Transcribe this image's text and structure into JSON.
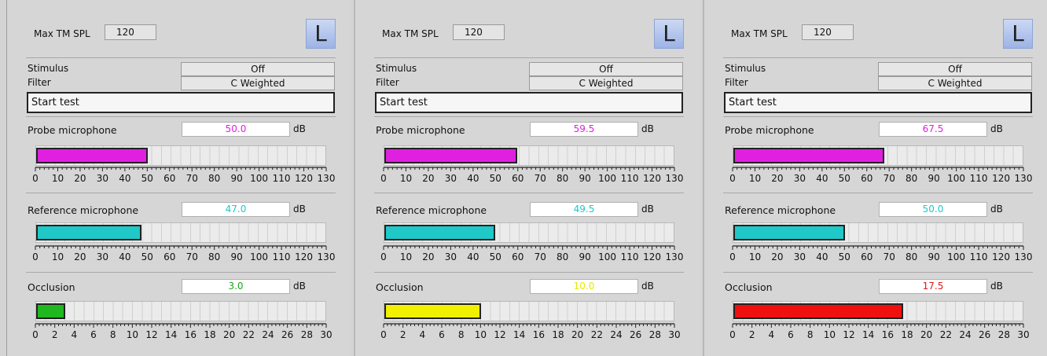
{
  "panels": [
    {
      "max_tm_spl_label": "Max TM SPL",
      "max_tm_spl_value": "120",
      "ear_button": "L",
      "stimulus_label": "Stimulus",
      "stimulus_value": "Off",
      "filter_label": "Filter",
      "filter_value": "C Weighted",
      "start_button": "Start test",
      "probe": {
        "label": "Probe microphone",
        "value": "50.0",
        "unit": "dB",
        "level": 50,
        "color": "#e020e0",
        "fill_color": "#e020e0"
      },
      "reference": {
        "label": "Reference microphone",
        "value": "47.0",
        "unit": "dB",
        "level": 47,
        "color": "#20c8c8",
        "fill_color": "#20c8c8"
      },
      "occlusion": {
        "label": "Occlusion",
        "value": "3.0",
        "unit": "dB",
        "level": 3,
        "color": "#1aa81a",
        "fill_color": "#1fb81f"
      }
    },
    {
      "max_tm_spl_label": "Max TM SPL",
      "max_tm_spl_value": "120",
      "ear_button": "L",
      "stimulus_label": "Stimulus",
      "stimulus_value": "Off",
      "filter_label": "Filter",
      "filter_value": "C Weighted",
      "start_button": "Start test",
      "probe": {
        "label": "Probe microphone",
        "value": "59.5",
        "unit": "dB",
        "level": 59.5,
        "color": "#e020e0",
        "fill_color": "#e020e0"
      },
      "reference": {
        "label": "Reference microphone",
        "value": "49.5",
        "unit": "dB",
        "level": 49.5,
        "color": "#20c8c8",
        "fill_color": "#20c8c8"
      },
      "occlusion": {
        "label": "Occlusion",
        "value": "10.0",
        "unit": "dB",
        "level": 10,
        "color": "#e8e800",
        "fill_color": "#f0f000"
      }
    },
    {
      "max_tm_spl_label": "Max TM SPL",
      "max_tm_spl_value": "120",
      "ear_button": "L",
      "stimulus_label": "Stimulus",
      "stimulus_value": "Off",
      "filter_label": "Filter",
      "filter_value": "C Weighted",
      "start_button": "Start test",
      "probe": {
        "label": "Probe microphone",
        "value": "67.5",
        "unit": "dB",
        "level": 67.5,
        "color": "#e020e0",
        "fill_color": "#e020e0"
      },
      "reference": {
        "label": "Reference microphone",
        "value": "50.0",
        "unit": "dB",
        "level": 50,
        "color": "#20c8c8",
        "fill_color": "#20c8c8"
      },
      "occlusion": {
        "label": "Occlusion",
        "value": "17.5",
        "unit": "dB",
        "level": 17.5,
        "color": "#e01818",
        "fill_color": "#f01010"
      }
    }
  ],
  "scales": {
    "spl": {
      "max": 130,
      "ticks": [
        "0",
        "10",
        "20",
        "30",
        "40",
        "50",
        "60",
        "70",
        "80",
        "90",
        "100",
        "110",
        "120",
        "130"
      ]
    },
    "occlusion": {
      "max": 30,
      "ticks": [
        "0",
        "2",
        "4",
        "6",
        "8",
        "10",
        "12",
        "14",
        "16",
        "18",
        "20",
        "22",
        "24",
        "26",
        "28",
        "30"
      ]
    }
  }
}
